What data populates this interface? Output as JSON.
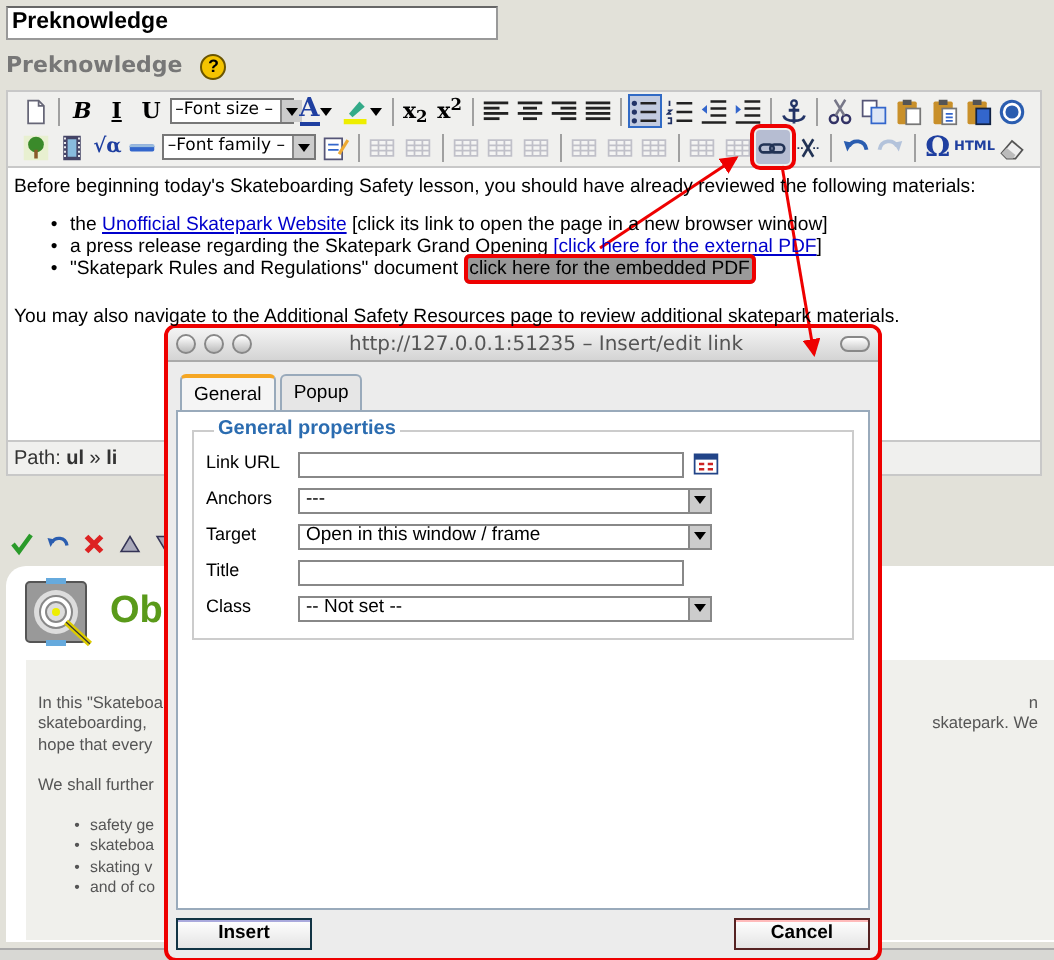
{
  "title_field": {
    "value": "Preknowledge"
  },
  "field_label": "Preknowledge",
  "help_glyph": "?",
  "toolbar": {
    "top_row": [
      {
        "kind": "icon",
        "active": false,
        "disabled": false
      },
      {
        "kind": "separator"
      },
      {
        "kind": "glyph",
        "label": "B",
        "active": false,
        "disabled": false
      },
      {
        "kind": "glyph",
        "label": "I",
        "active": false,
        "disabled": false
      },
      {
        "kind": "glyph",
        "label": "U",
        "active": false,
        "disabled": false
      },
      {
        "kind": "select",
        "label": "–Font size –",
        "active": false,
        "disabled": false
      },
      {
        "kind": "glyph",
        "label": "A",
        "active": false,
        "disabled": false,
        "menu": true
      },
      {
        "kind": "icon",
        "active": false,
        "disabled": false,
        "menu": true
      },
      {
        "kind": "separator"
      },
      {
        "kind": "glyph",
        "label": "x$_{2}$",
        "active": false,
        "disabled": false
      },
      {
        "kind": "glyph",
        "label": "x$^{2}$",
        "active": false,
        "disabled": false
      },
      {
        "kind": "separator"
      },
      {
        "kind": "icon",
        "active": false,
        "disabled": false
      },
      {
        "kind": "icon",
        "active": false,
        "disabled": false
      },
      {
        "kind": "icon",
        "active": false,
        "disabled": false
      },
      {
        "kind": "icon",
        "active": false,
        "disabled": false
      },
      {
        "kind": "separator"
      },
      {
        "kind": "icon",
        "active": true,
        "disabled": false
      },
      {
        "kind": "icon",
        "active": false,
        "disabled": false
      },
      {
        "kind": "icon",
        "active": false,
        "disabled": false
      },
      {
        "kind": "icon",
        "active": false,
        "disabled": false
      },
      {
        "kind": "separator"
      },
      {
        "kind": "icon",
        "active": false,
        "disabled": false
      },
      {
        "kind": "separator"
      },
      {
        "kind": "icon",
        "active": false,
        "disabled": false
      },
      {
        "kind": "icon",
        "active": false,
        "disabled": false
      },
      {
        "kind": "icon",
        "active": false,
        "disabled": false
      },
      {
        "kind": "icon",
        "active": false,
        "disabled": false
      },
      {
        "kind": "icon",
        "active": false,
        "disabled": false
      },
      {
        "kind": "icon",
        "active": false,
        "disabled": false
      }
    ],
    "bottom_row": [
      {
        "kind": "icon",
        "active": false,
        "disabled": false
      },
      {
        "kind": "icon",
        "active": false,
        "disabled": false
      },
      {
        "kind": "glyph",
        "label": "√α",
        "active": false,
        "disabled": false
      },
      {
        "kind": "icon",
        "active": false,
        "disabled": false
      },
      {
        "kind": "select",
        "label": "–Font family –",
        "active": false,
        "disabled": false
      },
      {
        "kind": "icon",
        "active": false,
        "disabled": false
      },
      {
        "kind": "separator"
      },
      {
        "kind": "icon",
        "active": false,
        "disabled": true
      },
      {
        "kind": "icon",
        "active": false,
        "disabled": true
      },
      {
        "kind": "separator"
      },
      {
        "kind": "icon",
        "active": false,
        "disabled": true
      },
      {
        "kind": "icon",
        "active": false,
        "disabled": true
      },
      {
        "kind": "icon",
        "active": false,
        "disabled": true
      },
      {
        "kind": "separator"
      },
      {
        "kind": "icon",
        "active": false,
        "disabled": true
      },
      {
        "kind": "icon",
        "active": false,
        "disabled": true
      },
      {
        "kind": "icon",
        "active": false,
        "disabled": true
      },
      {
        "kind": "separator"
      },
      {
        "kind": "icon",
        "active": false,
        "disabled": true
      },
      {
        "kind": "icon",
        "active": false,
        "disabled": true
      },
      {
        "kind": "callout",
        "active": true,
        "disabled": false
      },
      {
        "kind": "icon",
        "active": false,
        "disabled": false
      },
      {
        "kind": "separator"
      },
      {
        "kind": "icon",
        "active": false,
        "disabled": false
      },
      {
        "kind": "icon",
        "active": false,
        "disabled": true
      },
      {
        "kind": "separator"
      },
      {
        "kind": "glyph",
        "label": "Ω",
        "active": false,
        "disabled": false
      },
      {
        "kind": "glyph",
        "label": "HTML",
        "active": false,
        "disabled": false
      },
      {
        "kind": "icon",
        "active": false,
        "disabled": false
      }
    ]
  },
  "content": {
    "intro": "Before beginning today's Skateboarding Safety lesson, you should have already reviewed the following materials:",
    "items": [
      {
        "marker": "•",
        "parts": [
          {
            "kind": "text",
            "text": "the "
          },
          {
            "kind": "link",
            "text": "Unofficial Skatepark Website"
          },
          {
            "kind": "text",
            "text": " [click its link to open the page in a new browser window]"
          }
        ]
      },
      {
        "marker": "•",
        "parts": [
          {
            "kind": "text",
            "text": "a press release regarding the Skatepark Grand Opening "
          },
          {
            "kind": "link",
            "text": "[click here for the external PDF"
          },
          {
            "kind": "text",
            "text": "]"
          }
        ]
      },
      {
        "marker": "•",
        "parts": [
          {
            "kind": "text",
            "text": "\"Skatepark Rules and Regulations\" document "
          },
          {
            "kind": "marked-link",
            "text": "click here for the embedded PDF"
          }
        ]
      }
    ],
    "outro": "You may also navigate to the Additional Safety Resources page to review additional skatepark materials."
  },
  "path_bar": "Path: **ul** » **li**",
  "objective": {
    "heading": "Ob",
    "left_lines": [
      "In this \"Skateboa",
      "skateboarding, ",
      "hope that every"
    ],
    "right_lines": [
      "n",
      "skatepark. We"
    ],
    "paragraph": "We shall further",
    "list": [
      {
        "marker": "•",
        "text": "safety ge"
      },
      {
        "marker": "•",
        "text": "skateboa"
      },
      {
        "marker": "•",
        "text": "skating v"
      },
      {
        "marker": "•",
        "text": "and of co"
      }
    ]
  },
  "dialog": {
    "title": "http://127.0.0.1:51235 – Insert/edit link",
    "tabs": [
      {
        "label": "General",
        "selected": true
      },
      {
        "label": "Popup",
        "selected": false
      }
    ],
    "legend": "General properties",
    "fields": [
      {
        "label": "Link URL",
        "kind": "input-browse"
      },
      {
        "label": "Anchors",
        "kind": "select",
        "value": "---"
      },
      {
        "label": "Target",
        "kind": "select",
        "value": "Open in this window / frame"
      },
      {
        "label": "Title",
        "kind": "input"
      },
      {
        "label": "Class",
        "kind": "select",
        "value": "-- Not set --"
      }
    ],
    "buttons": [
      {
        "label": "Insert",
        "kind": "primary"
      },
      {
        "label": "Cancel",
        "kind": "cancel"
      }
    ]
  }
}
